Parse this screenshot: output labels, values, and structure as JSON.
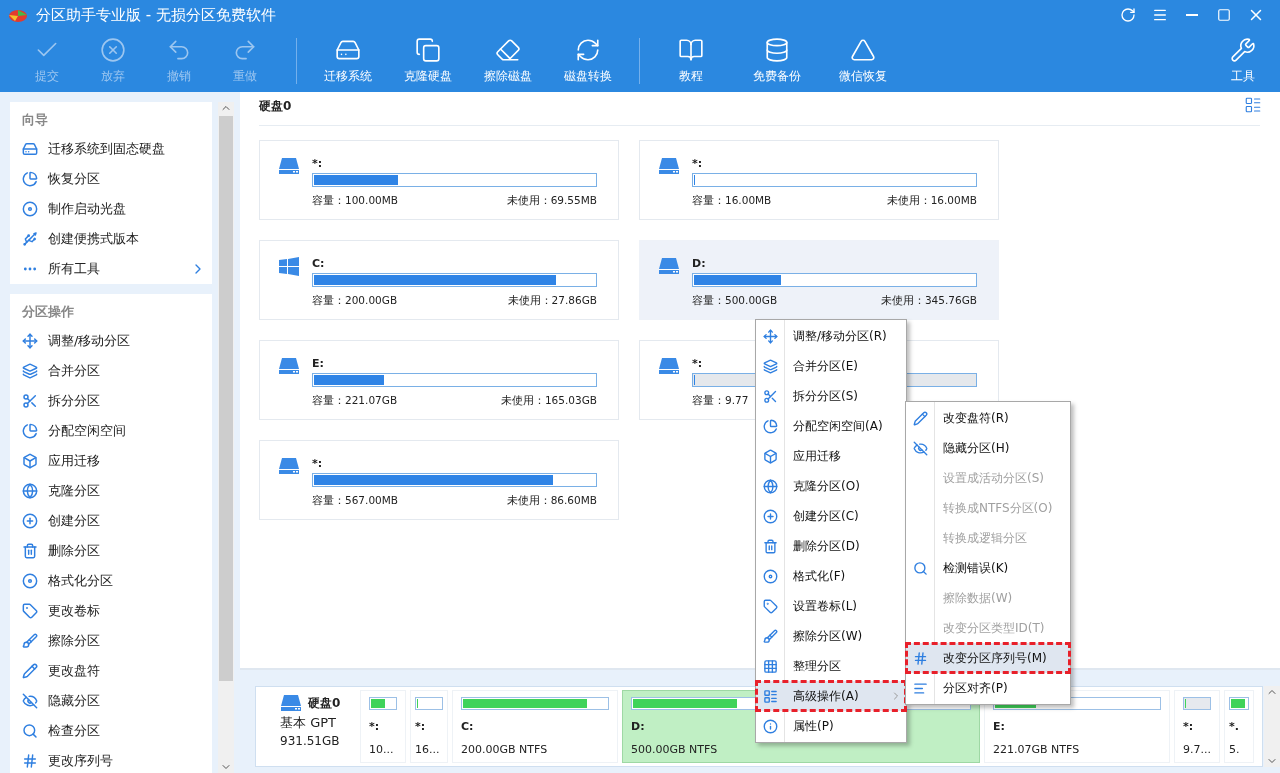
{
  "window": {
    "title": "分区助手专业版 - 无损分区免费软件"
  },
  "toolbar": [
    {
      "label": "提交",
      "disabled": true
    },
    {
      "label": "放弃",
      "disabled": true
    },
    {
      "label": "撤销",
      "disabled": true
    },
    {
      "label": "重做",
      "disabled": true
    },
    {
      "label": "迁移系统",
      "disabled": false
    },
    {
      "label": "克隆硬盘",
      "disabled": false
    },
    {
      "label": "擦除磁盘",
      "disabled": false
    },
    {
      "label": "磁盘转换",
      "disabled": false
    },
    {
      "label": "教程",
      "disabled": false
    },
    {
      "label": "免费备份",
      "disabled": false
    },
    {
      "label": "微信恢复",
      "disabled": false
    },
    {
      "label": "工具",
      "disabled": false
    }
  ],
  "sidebar": {
    "sections": [
      {
        "title": "向导",
        "items": [
          {
            "label": "迁移系统到固态硬盘"
          },
          {
            "label": "恢复分区"
          },
          {
            "label": "制作启动光盘"
          },
          {
            "label": "创建便携式版本"
          },
          {
            "label": "所有工具",
            "kind": "more"
          }
        ]
      },
      {
        "title": "分区操作",
        "items": [
          {
            "label": "调整/移动分区"
          },
          {
            "label": "合并分区"
          },
          {
            "label": "拆分分区"
          },
          {
            "label": "分配空闲空间"
          },
          {
            "label": "应用迁移"
          },
          {
            "label": "克隆分区"
          },
          {
            "label": "创建分区"
          },
          {
            "label": "删除分区"
          },
          {
            "label": "格式化分区"
          },
          {
            "label": "更改卷标"
          },
          {
            "label": "擦除分区"
          },
          {
            "label": "更改盘符"
          },
          {
            "label": "隐藏分区"
          },
          {
            "label": "检查分区"
          },
          {
            "label": "更改序列号"
          }
        ]
      }
    ]
  },
  "disk": {
    "title": "硬盘0",
    "partitions": [
      {
        "letter": "*:",
        "kind": "partition",
        "os": false,
        "level": 0.3,
        "capacity": "容量：100.00MB",
        "unused": "未使用：69.55MB",
        "selected": false
      },
      {
        "letter": "*:",
        "kind": "partition",
        "os": false,
        "level": 0,
        "capacity": "容量：16.00MB",
        "unused": "未使用：16.00MB",
        "selected": false
      },
      {
        "letter": "C:",
        "kind": "partition",
        "os": true,
        "level": 0.86,
        "capacity": "容量：200.00GB",
        "unused": "未使用：27.86GB",
        "selected": false
      },
      {
        "letter": "D:",
        "kind": "partition",
        "os": false,
        "level": 0.31,
        "capacity": "容量：500.00GB",
        "unused": "未使用：345.76GB",
        "selected": true
      },
      {
        "letter": "E:",
        "kind": "partition",
        "os": false,
        "level": 0.25,
        "capacity": "容量：221.07GB",
        "unused": "未使用：165.03GB",
        "selected": false
      },
      {
        "letter": "*:",
        "kind": "free",
        "os": false,
        "level": 0,
        "capacity": "容量：9.77",
        "selected": false
      },
      {
        "letter": "*:",
        "kind": "partition",
        "os": false,
        "level": 0.85,
        "capacity": "容量：567.00MB",
        "unused": "未使用：86.60MB",
        "selected": false
      }
    ]
  },
  "disk_map": {
    "name": "硬盘0",
    "type": "基本 GPT",
    "size": "931.51GB",
    "segments": [
      {
        "label": "*:",
        "info": "10...",
        "level": 0.6,
        "kind": "partition",
        "selected": false
      },
      {
        "label": "*:",
        "info": "16...",
        "level": 0,
        "kind": "partition",
        "selected": false
      },
      {
        "label": "C:",
        "info": "200.00GB NTFS",
        "level": 0.86,
        "kind": "partition",
        "selected": false
      },
      {
        "label": "D:",
        "info": "500.00GB NTFS",
        "level": 0.31,
        "kind": "partition",
        "selected": true
      },
      {
        "label": "E:",
        "info": "221.07GB NTFS",
        "level": 0.25,
        "kind": "partition",
        "selected": false
      },
      {
        "label": "*:",
        "info": "9.7...",
        "level": 0,
        "kind": "free",
        "selected": false
      },
      {
        "label": "*.",
        "info": "5.",
        "level": 0.85,
        "kind": "partition",
        "selected": false
      }
    ]
  },
  "context_menu": {
    "items": [
      {
        "label": "调整/移动分区(R)",
        "kind": "item",
        "selected": false,
        "marked": false
      },
      {
        "label": "合并分区(E)",
        "kind": "item",
        "selected": false,
        "marked": false
      },
      {
        "label": "拆分分区(S)",
        "kind": "item",
        "selected": false,
        "marked": false
      },
      {
        "label": "分配空闲空间(A)",
        "kind": "item",
        "selected": false,
        "marked": false
      },
      {
        "label": "应用迁移",
        "kind": "item",
        "selected": false,
        "marked": false
      },
      {
        "label": "克隆分区(O)",
        "kind": "item",
        "selected": false,
        "marked": false
      },
      {
        "label": "创建分区(C)",
        "kind": "item",
        "selected": false,
        "marked": false
      },
      {
        "label": "删除分区(D)",
        "kind": "item",
        "selected": false,
        "marked": false
      },
      {
        "label": "格式化(F)",
        "kind": "item",
        "selected": false,
        "marked": false
      },
      {
        "label": "设置卷标(L)",
        "kind": "item",
        "selected": false,
        "marked": false
      },
      {
        "label": "擦除分区(W)",
        "kind": "item",
        "selected": false,
        "marked": false
      },
      {
        "label": "整理分区",
        "kind": "item",
        "selected": false,
        "marked": false
      },
      {
        "label": "高级操作(A)",
        "kind": "submenu",
        "selected": true,
        "marked": true
      },
      {
        "label": "属性(P)",
        "kind": "item",
        "selected": false,
        "marked": false
      }
    ]
  },
  "submenu": {
    "items": [
      {
        "label": "改变盘符(R)",
        "disabled": false,
        "selected": false,
        "marked": false
      },
      {
        "label": "隐藏分区(H)",
        "disabled": false,
        "selected": false,
        "marked": false
      },
      {
        "label": "设置成活动分区(S)",
        "disabled": true,
        "selected": false,
        "marked": false
      },
      {
        "label": "转换成NTFS分区(O)",
        "disabled": true,
        "selected": false,
        "marked": false
      },
      {
        "label": "转换成逻辑分区",
        "disabled": true,
        "selected": false,
        "marked": false
      },
      {
        "label": "检测错误(K)",
        "disabled": false,
        "selected": false,
        "marked": false
      },
      {
        "label": "擦除数据(W)",
        "disabled": true,
        "selected": false,
        "marked": false
      },
      {
        "label": "改变分区类型ID(T)",
        "disabled": true,
        "selected": false,
        "marked": false
      },
      {
        "label": "改变分区序列号(M)",
        "disabled": false,
        "selected": true,
        "marked": true
      },
      {
        "label": "分区对齐(P)",
        "disabled": false,
        "selected": false,
        "marked": false
      }
    ]
  }
}
